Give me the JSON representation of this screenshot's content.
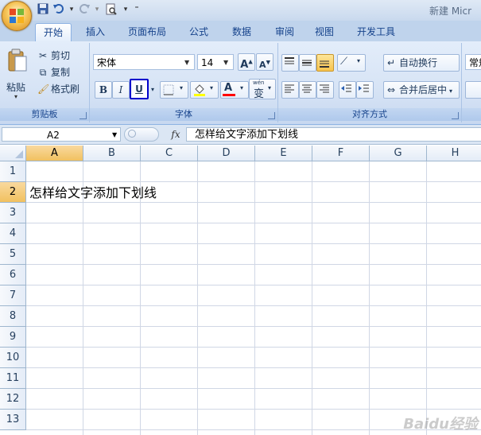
{
  "window": {
    "title": "新建 Micr"
  },
  "quick_access": {
    "icons": [
      "save-icon",
      "undo-icon",
      "redo-icon",
      "print-preview-icon",
      "customize-icon"
    ]
  },
  "tabs": [
    {
      "label": "开始",
      "active": true
    },
    {
      "label": "插入"
    },
    {
      "label": "页面布局"
    },
    {
      "label": "公式"
    },
    {
      "label": "数据"
    },
    {
      "label": "审阅"
    },
    {
      "label": "视图"
    },
    {
      "label": "开发工具"
    }
  ],
  "clipboard": {
    "paste_label": "粘贴",
    "cut_label": "剪切",
    "copy_label": "复制",
    "format_painter_label": "格式刷",
    "group_label": "剪贴板"
  },
  "font": {
    "name": "宋体",
    "size": "14",
    "bold_label": "B",
    "italic_label": "I",
    "underline_label": "U",
    "font_color_label": "A",
    "phonetic_label": "变",
    "phonetic_top": "wén",
    "group_label": "字体",
    "underline_highlight_color": "#0000cc",
    "font_color": "#ff0000",
    "fill_color": "#ffff00"
  },
  "alignment": {
    "wrap_label": "自动换行",
    "merge_label": "合并后居中",
    "group_label": "对齐方式"
  },
  "number": {
    "format_partial": "常规"
  },
  "formula_bar": {
    "name_box": "A2",
    "fx_label": "fx",
    "content": "怎样给文字添加下划线"
  },
  "sheet": {
    "columns": [
      "A",
      "B",
      "C",
      "D",
      "E",
      "F",
      "G",
      "H"
    ],
    "rows": [
      "1",
      "2",
      "3",
      "4",
      "5",
      "6",
      "7",
      "8",
      "9",
      "10",
      "11",
      "12",
      "13"
    ],
    "selected_cell": "A2",
    "cell_a2": "怎样给文字添加下划线"
  },
  "watermark": "Baidu经验"
}
